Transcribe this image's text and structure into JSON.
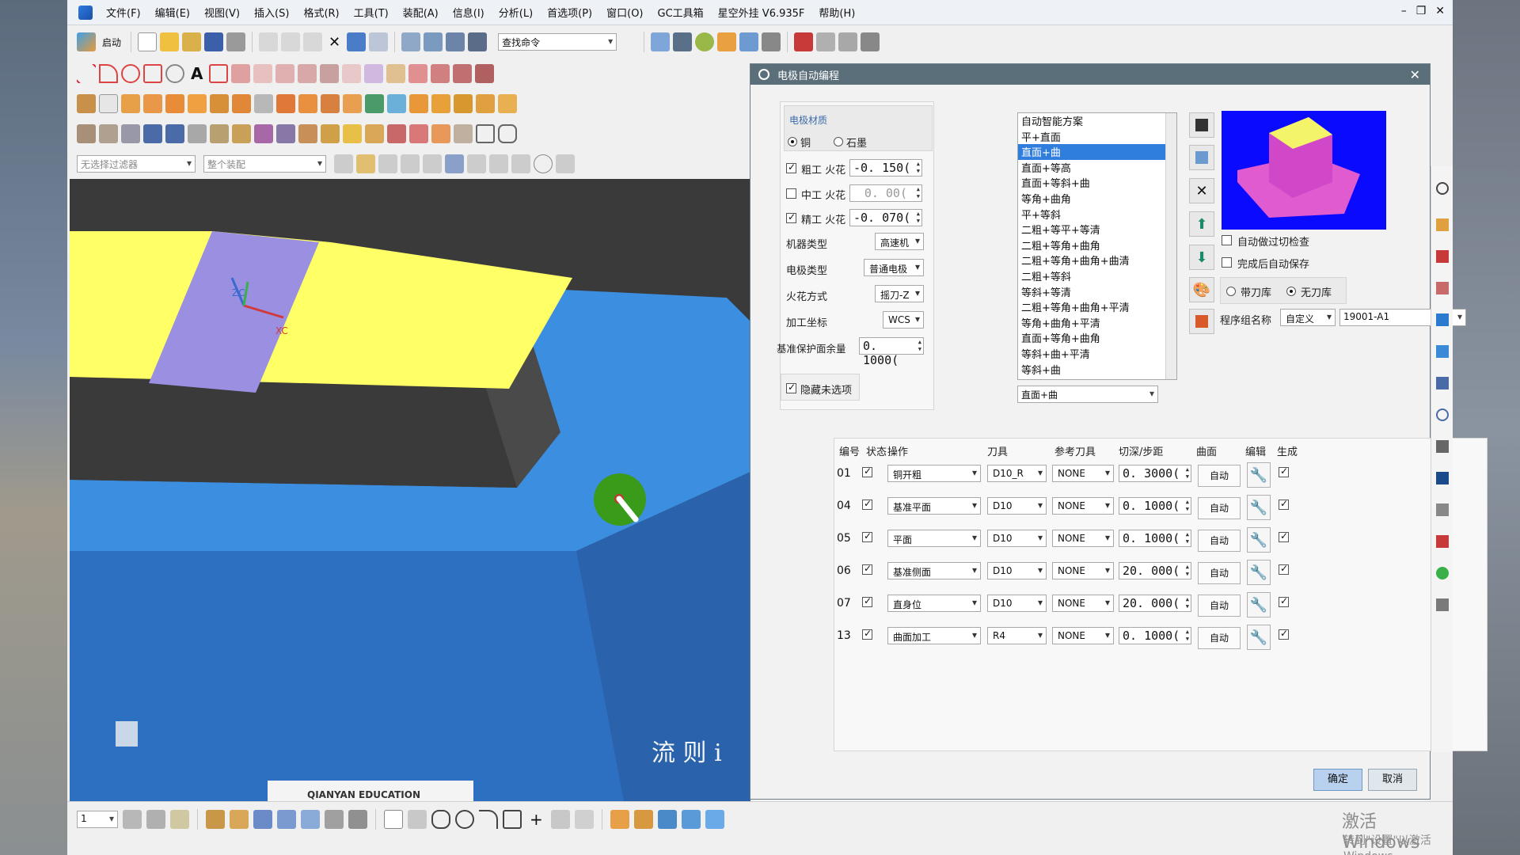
{
  "menu": [
    "文件(F)",
    "编辑(E)",
    "视图(V)",
    "插入(S)",
    "格式(R)",
    "工具(T)",
    "装配(A)",
    "信息(I)",
    "分析(L)",
    "首选项(P)",
    "窗口(O)",
    "GC工具箱",
    "星空外挂 V6.935F",
    "帮助(H)"
  ],
  "toolbar": {
    "start_label": "启动",
    "find_command": "查找命令",
    "filter_placeholder": "无选择过滤器",
    "assembly_placeholder": "整个装配",
    "layer_value": "1"
  },
  "viewport": {
    "wcs_label_z": "ZC",
    "wcs_label_x": "XC",
    "overlay_text": "流 则 i",
    "logo_text": "QIANYAN EDUCATION",
    "colors": {
      "top_face": "#ffff66",
      "band": "#9a8fe0",
      "side": "#4a4a4a",
      "base": "#3c8ee0",
      "base_dark": "#2d6fc0",
      "bg": "#3a3a3a"
    }
  },
  "dialog": {
    "title": "电极自动编程",
    "material": {
      "group_label": "电极材质",
      "copper": "铜",
      "graphite": "石墨",
      "selected": "铜"
    },
    "spark": [
      {
        "label": "粗工 火花",
        "checked": true,
        "value": "-0. 150("
      },
      {
        "label": "中工 火花",
        "checked": false,
        "value": "0. 00("
      },
      {
        "label": "精工 火花",
        "checked": true,
        "value": "-0. 070("
      }
    ],
    "fields": [
      {
        "label": "机器类型",
        "value": "高速机"
      },
      {
        "label": "电极类型",
        "value": "普通电极"
      },
      {
        "label": "火花方式",
        "value": "摇刀-Z"
      },
      {
        "label": "加工坐标",
        "value": "WCS"
      }
    ],
    "base_allowance_label": "基准保护面余量",
    "base_allowance_value": "0. 1000(",
    "hide_unselected": "隐藏未选项",
    "schemes": [
      "自动智能方案",
      "平+直面",
      "直面+曲",
      "直面+等高",
      "直面+等斜+曲",
      "等角+曲角",
      "平+等斜",
      "二粗+等平+等清",
      "二粗+等角+曲角",
      "二粗+等角+曲角+曲清",
      "二粗+等斜",
      "等斜+等清",
      "二粗+等角+曲角+平清",
      "等角+曲角+平清",
      "直面+等角+曲角",
      "等斜+曲+平清",
      "等斜+曲"
    ],
    "selected_scheme": "直面+曲",
    "scheme_input": "直面+曲",
    "auto_check": "自动做过切检查",
    "auto_save": "完成后自动保存",
    "tool_lib_with": "带刀库",
    "tool_lib_without": "无刀库",
    "tool_lib_selected": "无刀库",
    "program_group_label": "程序组名称",
    "program_group_mode": "自定义",
    "program_group_value": "19001-A1",
    "table_headers": [
      "编号",
      "状态",
      "操作",
      "刀具",
      "参考刀具",
      "切深/步距",
      "曲面",
      "编辑",
      "生成"
    ],
    "rows": [
      {
        "id": "01",
        "status": true,
        "op": "铜开粗",
        "tool": "D10_R",
        "ref": "NONE",
        "depth": "0. 3000(",
        "surface": "自动",
        "gen": true
      },
      {
        "id": "04",
        "status": true,
        "op": "基准平面",
        "tool": "D10",
        "ref": "NONE",
        "depth": "0. 1000(",
        "surface": "自动",
        "gen": true
      },
      {
        "id": "05",
        "status": true,
        "op": "平面",
        "tool": "D10",
        "ref": "NONE",
        "depth": "0. 1000(",
        "surface": "自动",
        "gen": true
      },
      {
        "id": "06",
        "status": true,
        "op": "基准侧面",
        "tool": "D10",
        "ref": "NONE",
        "depth": "20. 000(",
        "surface": "自动",
        "gen": true
      },
      {
        "id": "07",
        "status": true,
        "op": "直身位",
        "tool": "D10",
        "ref": "NONE",
        "depth": "20. 000(",
        "surface": "自动",
        "gen": true
      },
      {
        "id": "13",
        "status": true,
        "op": "曲面加工",
        "tool": "R4",
        "ref": "NONE",
        "depth": "0. 1000(",
        "surface": "自动",
        "gen": true
      }
    ],
    "ok": "确定",
    "cancel": "取消"
  },
  "watermark": {
    "line1": "激活 Windows",
    "line2": "转到\"设置\"以激活Windows。"
  }
}
